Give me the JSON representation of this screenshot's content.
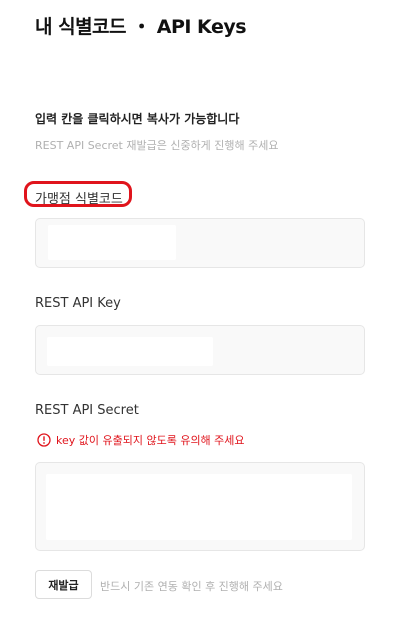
{
  "header": {
    "title": "내 식별코드 ・ API Keys"
  },
  "intro": {
    "instruction": "입력 칸을 클릭하시면 복사가 가능합니다",
    "note": "REST API Secret 재발급은 신중하게 진행해 주세요"
  },
  "fields": {
    "merchant_code": {
      "label": "가맹점 식별코드",
      "value": ""
    },
    "rest_api_key": {
      "label": "REST API Key",
      "value": ""
    },
    "rest_api_secret": {
      "label": "REST API Secret",
      "value": "",
      "warning": "key 값이 유출되지 않도록 유의해 주세요"
    }
  },
  "reissue": {
    "button_label": "재발급",
    "note": "반드시 기존 연동 확인 후 진행해 주세요"
  },
  "icons": {
    "warning": "warning-circle-icon"
  },
  "colors": {
    "highlight": "#e0141c",
    "warning_text": "#e0141c",
    "muted_text": "#b0b0b0",
    "field_background": "#f9f9f9",
    "field_border": "#e6e6e6"
  }
}
